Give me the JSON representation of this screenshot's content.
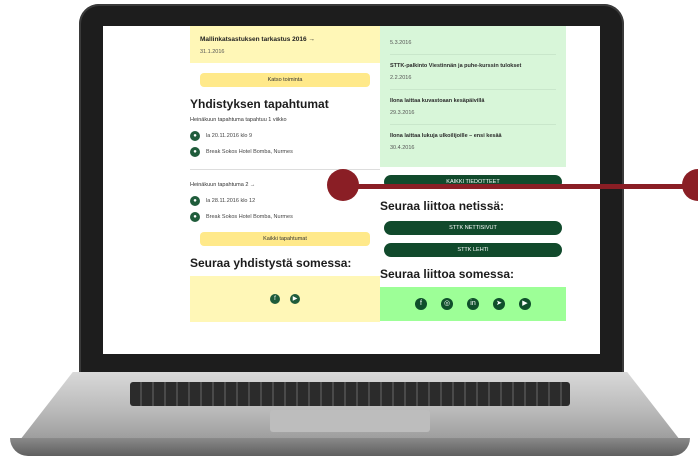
{
  "left": {
    "top_card": {
      "title": "Mallinkatsastuksen tarkastus 2016 →",
      "date": "31.1.2016"
    },
    "button_1": "Katso toiminta",
    "section_title": "Yhdistyksen tapahtumat",
    "event_1": {
      "title": "Heinäkuun tapahtuma tapahtuu 1 viikko",
      "date": "la 20.11.2016 klo 9",
      "place": "Break Sokos Hotel Bomba, Nurmes"
    },
    "event_2": {
      "title": "Heinäkuun tapahtuma 2 →",
      "date": "la 28.11.2016 klo 12",
      "place": "Break Sokos Hotel Bomba, Nurmes"
    },
    "button_2": "Kaikki tapahtumat",
    "social_title": "Seuraa yhdistystä somessa:",
    "social_icons": [
      "facebook-icon",
      "youtube-icon"
    ]
  },
  "right": {
    "top_date": "5.3.2016",
    "news": [
      {
        "title": "STTK-palkinto Viestinnän ja puhe-kurssin tulokset",
        "date": "2.2.2016"
      },
      {
        "title": "Ilona laittaa kuvastoaan kesäpäivillä",
        "date": "29.3.2016"
      },
      {
        "title": "Ilona laittaa lukuja ulkoilijoille – ensi kesää",
        "date": "30.4.2016"
      }
    ],
    "button_1": "KAIKKI TIEDOTTEET",
    "follow_title": "Seuraa liittoa netissä:",
    "button_2": "STTK NETTISIVUT",
    "button_3": "STTK LEHTI",
    "social_title": "Seuraa liittoa somessa:",
    "social_icons": [
      "facebook-icon",
      "instagram-icon",
      "linkedin-icon",
      "telegram-icon",
      "youtube-icon"
    ]
  }
}
